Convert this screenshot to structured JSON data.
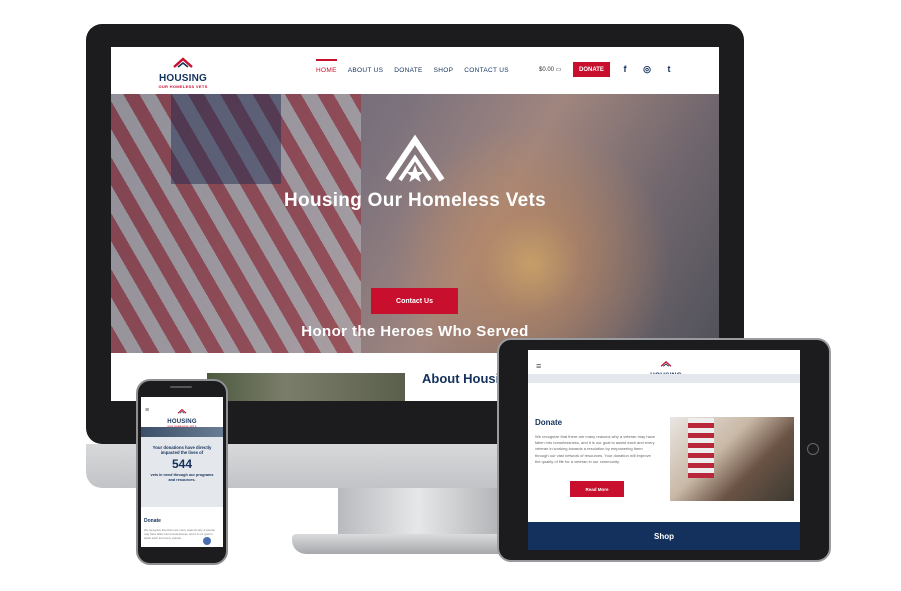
{
  "brand": {
    "logo_main": "HOUSING",
    "logo_sub": "OUR HOMELESS VETS",
    "primary_color": "#13315c",
    "accent_color": "#c8102e"
  },
  "desktop": {
    "nav": {
      "items": [
        "HOME",
        "ABOUT US",
        "DONATE",
        "SHOP",
        "CONTACT US"
      ],
      "active": "HOME"
    },
    "cart_text": "$0.00",
    "donate_button": "DONATE",
    "social_icons": [
      "facebook-icon",
      "instagram-icon",
      "twitter-icon"
    ],
    "social_glyphs": [
      "f",
      "◎",
      "t"
    ],
    "hero": {
      "title": "Housing Our Homeless Vets",
      "button": "Contact Us",
      "subtitle": "Honor the Heroes Who Served"
    },
    "about_heading": "About Housing Our Homeless Vets"
  },
  "tablet": {
    "menu_glyph": "≡",
    "donate_title": "Donate",
    "donate_text": "We recognize that there are many reasons why a veteran may have fallen into homelessness, and it is our goal to assist each and every veteran in working towards a resolution by empowering them through our vast network of resources. Your donation will improve the quality of life for a veteran in our community.",
    "read_more_button": "Read More",
    "shop_label": "Shop"
  },
  "phone": {
    "menu_glyph": "≡",
    "impact_text_1": "Your donations have directly impacted the lives of",
    "impact_count": "544",
    "impact_text_2": "vets in need through our programs and resources.",
    "donate_title": "Donate",
    "donate_text": "We recognize that there are many reasons why a veteran may have fallen into homelessness, and it is our goal to assist each and every veteran."
  }
}
